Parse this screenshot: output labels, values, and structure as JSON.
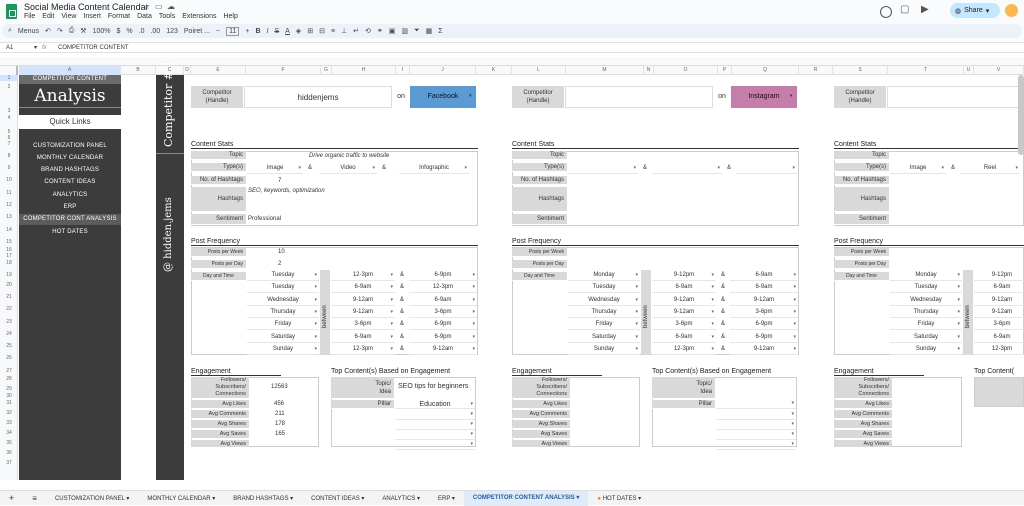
{
  "doc_title": "Social Media Content Calendar",
  "menu": [
    "File",
    "Edit",
    "View",
    "Insert",
    "Format",
    "Data",
    "Tools",
    "Extensions",
    "Help"
  ],
  "toolbar": {
    "menus": "Menus",
    "zoom": "100%",
    "currency": "$",
    "percent": "%",
    "dec1": ".0",
    "dec2": ".00",
    "fmt": "123",
    "font": "Poiret ...",
    "size": "11",
    "share": "Share"
  },
  "formula": {
    "cellref": "A1",
    "fx": "fx",
    "content": "COMPETITOR CONTENT"
  },
  "columns": [
    "A",
    "B",
    "C",
    "D",
    "E",
    "F",
    "G",
    "H",
    "I",
    "J",
    "K",
    "L",
    "M",
    "N",
    "O",
    "P",
    "Q",
    "R",
    "S",
    "T",
    "U",
    "V"
  ],
  "rows": [
    "1",
    "2",
    "3",
    "4",
    "5",
    "6",
    "7",
    "8",
    "9",
    "10",
    "11",
    "12",
    "13",
    "14",
    "15",
    "16",
    "17",
    "18",
    "19",
    "20",
    "21",
    "22",
    "23",
    "24",
    "25",
    "26",
    "27",
    "28",
    "29",
    "30",
    "31",
    "32",
    "33",
    "34",
    "35",
    "36",
    "37"
  ],
  "sidebar": {
    "header": "COMPETITOR CONTENT",
    "title": "Analysis",
    "quick": "Quick Links",
    "items": [
      "CUSTOMIZATION PANEL",
      "MONTHLY CALENDAR",
      "BRAND HASHTAGS",
      "CONTENT IDEAS",
      "ANALYTICS",
      "ERP",
      "COMPETITOR CONT ANALYSIS",
      "HOT DATES"
    ]
  },
  "band": {
    "competitor": "Competitor # 1",
    "handle": "@ hidden.jems"
  },
  "labels": {
    "competitor_handle": "Competitor\n(Handle)",
    "on": "on",
    "content_stats": "Content Stats",
    "topic": "Topic",
    "types": "Type(s)",
    "no_hashtags": "No. of Hashtags",
    "hashtags": "Hashtags",
    "sentiment": "Sentiment",
    "post_frequency": "Post Frequency",
    "ppw": "Posts per Week",
    "ppd": "Posts per Day",
    "day_time": "Day and Time",
    "between": "between",
    "amp": "&",
    "engagement": "Engagement",
    "followers": "Followers/\nSubscribers/\nConnections",
    "likes": "Avg Likes",
    "comments": "Avg Comments",
    "shares": "Avg Shares",
    "saves": "Avg Saves",
    "views": "Avg Views",
    "top_content": "Top Content(s) Based on Engagement",
    "topic_idea": "Topic/\nIdea",
    "pillar": "Pillar"
  },
  "panel1": {
    "handle": "hiddenjems",
    "platform": "Facebook",
    "platform_color": "#5b9bd5",
    "topic": "Drive organic traffic to website",
    "types": [
      "Image",
      "Video",
      "Infographic"
    ],
    "no_hashtags": "7",
    "hashtags": "SEO, keywords, optimization",
    "sentiment": "Professional",
    "ppw": "10",
    "ppd": "2",
    "schedule": [
      [
        "Tuesday",
        "12-3pm",
        "6-9pm"
      ],
      [
        "Tuesday",
        "6-9am",
        "12-3pm"
      ],
      [
        "Wednesday",
        "9-12am",
        "6-9am"
      ],
      [
        "Thursday",
        "9-12am",
        "3-6pm"
      ],
      [
        "Friday",
        "3-6pm",
        "6-9pm"
      ],
      [
        "Saturday",
        "6-9am",
        "6-9pm"
      ],
      [
        "Sunday",
        "12-3pm",
        "9-12am"
      ]
    ],
    "followers": "12563",
    "likes": "456",
    "comments": "211",
    "shares": "178",
    "saves": "165",
    "top_topic": "SEO tips for beginners",
    "top_pillar": "Education"
  },
  "panel2": {
    "platform": "Instagram",
    "platform_color": "#c77dab",
    "schedule": [
      [
        "Monday",
        "9-12pm",
        "6-9am"
      ],
      [
        "Tuesday",
        "6-9am",
        "6-9am"
      ],
      [
        "Wednesday",
        "9-12am",
        "9-12am"
      ],
      [
        "Thursday",
        "9-12am",
        "3-6pm"
      ],
      [
        "Friday",
        "3-6pm",
        "6-9pm"
      ],
      [
        "Saturday",
        "6-9am",
        "6-9pm"
      ],
      [
        "Sunday",
        "12-3pm",
        "9-12am"
      ]
    ]
  },
  "panel3": {
    "types": [
      "Image",
      "Reel"
    ],
    "schedule": [
      [
        "Monday",
        "9-12pm"
      ],
      [
        "Tuesday",
        "6-9am"
      ],
      [
        "Wednesday",
        "9-12am"
      ],
      [
        "Thursday",
        "9-12am"
      ],
      [
        "Friday",
        "3-6pm"
      ],
      [
        "Saturday",
        "6-9am"
      ],
      [
        "Sunday",
        "12-3pm"
      ]
    ],
    "top_content": "Top Content("
  },
  "tabs": [
    "CUSTOMIZATION PANEL",
    "MONTHLY CALENDAR",
    "BRAND HASHTAGS",
    "CONTENT IDEAS",
    "ANALYTICS",
    "ERP",
    "COMPETITOR CONTENT ANALYSIS",
    "HOT DATES"
  ],
  "active_tab": "COMPETITOR CONTENT ANALYSIS"
}
